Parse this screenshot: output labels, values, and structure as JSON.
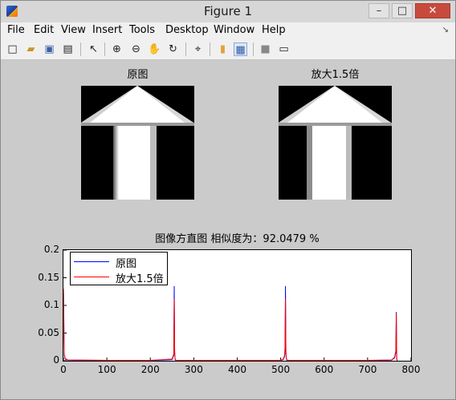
{
  "window": {
    "title": "Figure 1",
    "controls": {
      "minimize": "–",
      "maximize": "□",
      "close": "✕"
    }
  },
  "menu": {
    "items": [
      "File",
      "Edit",
      "View",
      "Insert",
      "Tools",
      "Desktop",
      "Window",
      "Help"
    ],
    "overflow_arrow": "↘"
  },
  "toolbar": {
    "icons": [
      "new-figure-icon",
      "open-file-icon",
      "save-icon",
      "print-icon",
      "edit-plot-arrow-icon",
      "zoom-in-icon",
      "zoom-out-icon",
      "pan-hand-icon",
      "rotate-3d-icon",
      "data-cursor-icon",
      "colorbar-icon",
      "legend-icon",
      "hide-plot-tools-icon",
      "show-plot-tools-icon"
    ],
    "glyphs": [
      "□",
      "▰",
      "▣",
      "▤",
      "↖",
      "⊕",
      "⊖",
      "✋",
      "↻",
      "⌖",
      "▮",
      "▦",
      "■",
      "▭"
    ]
  },
  "subplots": {
    "original_title": "原图",
    "scaled_title": "放大1.5倍",
    "histogram_title": "图像方直图 相似度为：92.0479 %"
  },
  "chart_data": {
    "type": "line",
    "title": "图像方直图 相似度为：92.0479 %",
    "xlabel": "",
    "ylabel": "",
    "xlim": [
      0,
      800
    ],
    "ylim": [
      0,
      0.2
    ],
    "xticks": [
      0,
      100,
      200,
      300,
      400,
      500,
      600,
      700,
      800
    ],
    "yticks": [
      0,
      0.05,
      0.1,
      0.15,
      0.2
    ],
    "ytick_labels": [
      "0",
      "0.05",
      "0.1",
      "0.15",
      "0.2"
    ],
    "legend_position": "top-left",
    "series": [
      {
        "name": "原图",
        "color": "#0000ff",
        "x": [
          0,
          1,
          2,
          4,
          10,
          100,
          200,
          250,
          254,
          255,
          256,
          257,
          258,
          260,
          262,
          300,
          400,
          500,
          506,
          509,
          510,
          511,
          512,
          513,
          514,
          518,
          600,
          700,
          755,
          762,
          765,
          766,
          767,
          768
        ],
        "y": [
          0.13,
          0.075,
          0.01,
          0.003,
          0.001,
          0.0005,
          0.0005,
          0.002,
          0.01,
          0.135,
          0.015,
          0.003,
          0.001,
          0.0005,
          0.0005,
          0.0005,
          0.0005,
          0.0005,
          0.002,
          0.008,
          0.02,
          0.135,
          0.012,
          0.004,
          0.001,
          0.0005,
          0.0005,
          0.0005,
          0.001,
          0.005,
          0.015,
          0.088,
          0.004,
          0.0
        ]
      },
      {
        "name": "放大1.5倍",
        "color": "#ff0000",
        "x": [
          0,
          1,
          2,
          4,
          10,
          100,
          200,
          250,
          254,
          255,
          256,
          257,
          258,
          260,
          262,
          300,
          400,
          500,
          506,
          509,
          510,
          511,
          512,
          513,
          514,
          518,
          600,
          700,
          755,
          762,
          765,
          766,
          767,
          768
        ],
        "y": [
          0.13,
          0.073,
          0.012,
          0.004,
          0.0015,
          0.0008,
          0.0008,
          0.003,
          0.012,
          0.112,
          0.018,
          0.004,
          0.0015,
          0.0008,
          0.0008,
          0.0008,
          0.0008,
          0.0008,
          0.003,
          0.01,
          0.025,
          0.112,
          0.015,
          0.005,
          0.0015,
          0.0008,
          0.0008,
          0.0008,
          0.0015,
          0.006,
          0.018,
          0.085,
          0.005,
          0.0
        ]
      }
    ]
  }
}
